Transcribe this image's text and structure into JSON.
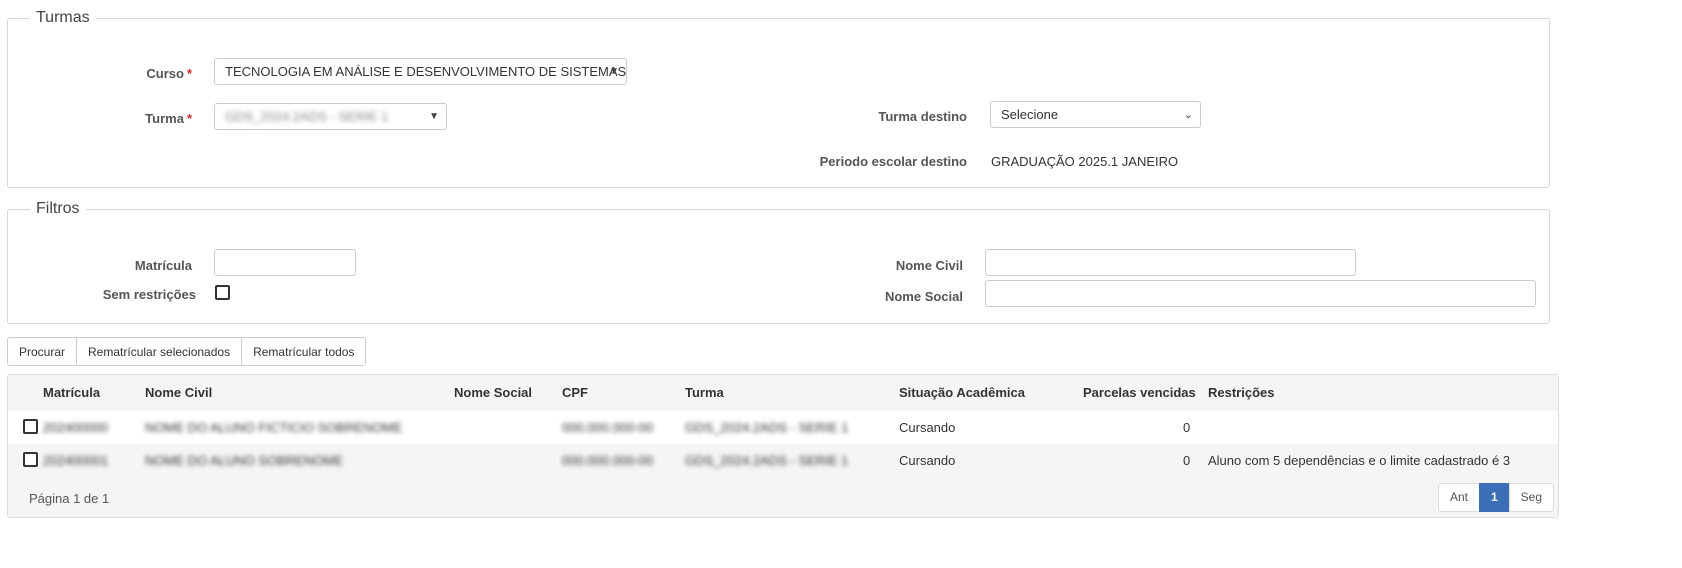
{
  "turmas": {
    "legend": "Turmas",
    "curso_label": "Curso",
    "required_mark": "*",
    "curso_value": "TECNOLOGIA EM ANÁLISE E DESENVOLVIMENTO DE SISTEMAS",
    "turma_label": "Turma",
    "turma_value": "GDS_2024.2ADS - SERIE 1",
    "turma_destino_label": "Turma destino",
    "turma_destino_value": "Selecione",
    "periodo_label": "Periodo escolar destino",
    "periodo_value": "GRADUAÇÃO 2025.1 JANEIRO"
  },
  "filtros": {
    "legend": "Filtros",
    "matricula_label": "Matrícula",
    "matricula_value": "",
    "sem_restricoes_label": "Sem restrições",
    "nome_civil_label": "Nome Civil",
    "nome_civil_value": "",
    "nome_social_label": "Nome Social",
    "nome_social_value": ""
  },
  "actions": {
    "procurar": "Procurar",
    "rematricular_selecionados": "Rematrícular selecionados",
    "rematricular_todos": "Rematrícular todos"
  },
  "table": {
    "headers": {
      "matricula": "Matrícula",
      "nome_civil": "Nome Civil",
      "nome_social": "Nome Social",
      "cpf": "CPF",
      "turma": "Turma",
      "situacao": "Situação Acadêmica",
      "parcelas": "Parcelas vencidas",
      "restricoes": "Restrições"
    },
    "rows": [
      {
        "matricula": "202400000",
        "nome_civil": "NOME DO ALUNO FICTICIO SOBRENOME",
        "nome_social": "",
        "cpf": "000.000.000-00",
        "turma": "GDS_2024.2ADS - SERIE 1",
        "situacao": "Cursando",
        "parcelas": "0",
        "restricoes": ""
      },
      {
        "matricula": "202400001",
        "nome_civil": "NOME DO ALUNO SOBRENOME",
        "nome_social": "",
        "cpf": "000.000.000-00",
        "turma": "GDS_2024.2ADS - SERIE 1",
        "situacao": "Cursando",
        "parcelas": "0",
        "restricoes": "Aluno com 5 dependências e o limite cadastrado é 3"
      }
    ],
    "footer": "Página 1 de 1",
    "pager": {
      "prev": "Ant",
      "current": "1",
      "next": "Seg"
    }
  }
}
